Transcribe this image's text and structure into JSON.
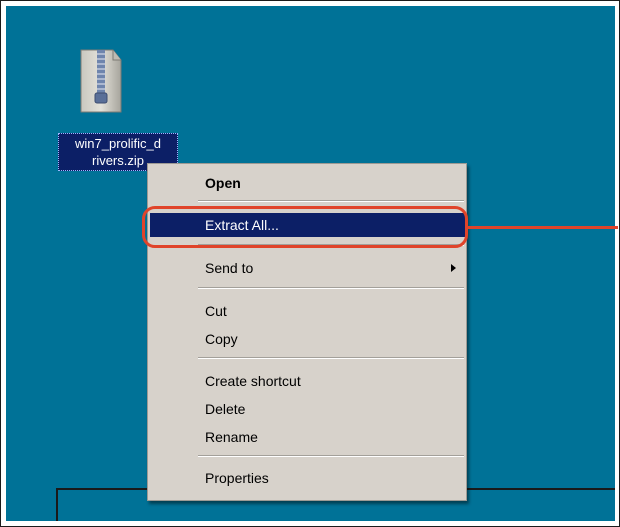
{
  "desktop": {
    "file": {
      "name": "win7_prolific_d\nrivers.zip",
      "line1": "win7_prolific_d",
      "line2": "rivers.zip",
      "icon": "zip-archive-icon"
    }
  },
  "context_menu": {
    "items": [
      {
        "label": "Open",
        "bold": true
      },
      {
        "label": "Extract All...",
        "highlighted": true
      },
      {
        "label": "Send to",
        "submenu": true
      },
      {
        "label": "Cut"
      },
      {
        "label": "Copy"
      },
      {
        "label": "Create shortcut"
      },
      {
        "label": "Delete"
      },
      {
        "label": "Rename"
      },
      {
        "label": "Properties"
      }
    ]
  },
  "colors": {
    "desktop": "#007297",
    "highlight": "#0c1f66",
    "menu": "#d7d2cb",
    "callout": "#e0442a"
  }
}
